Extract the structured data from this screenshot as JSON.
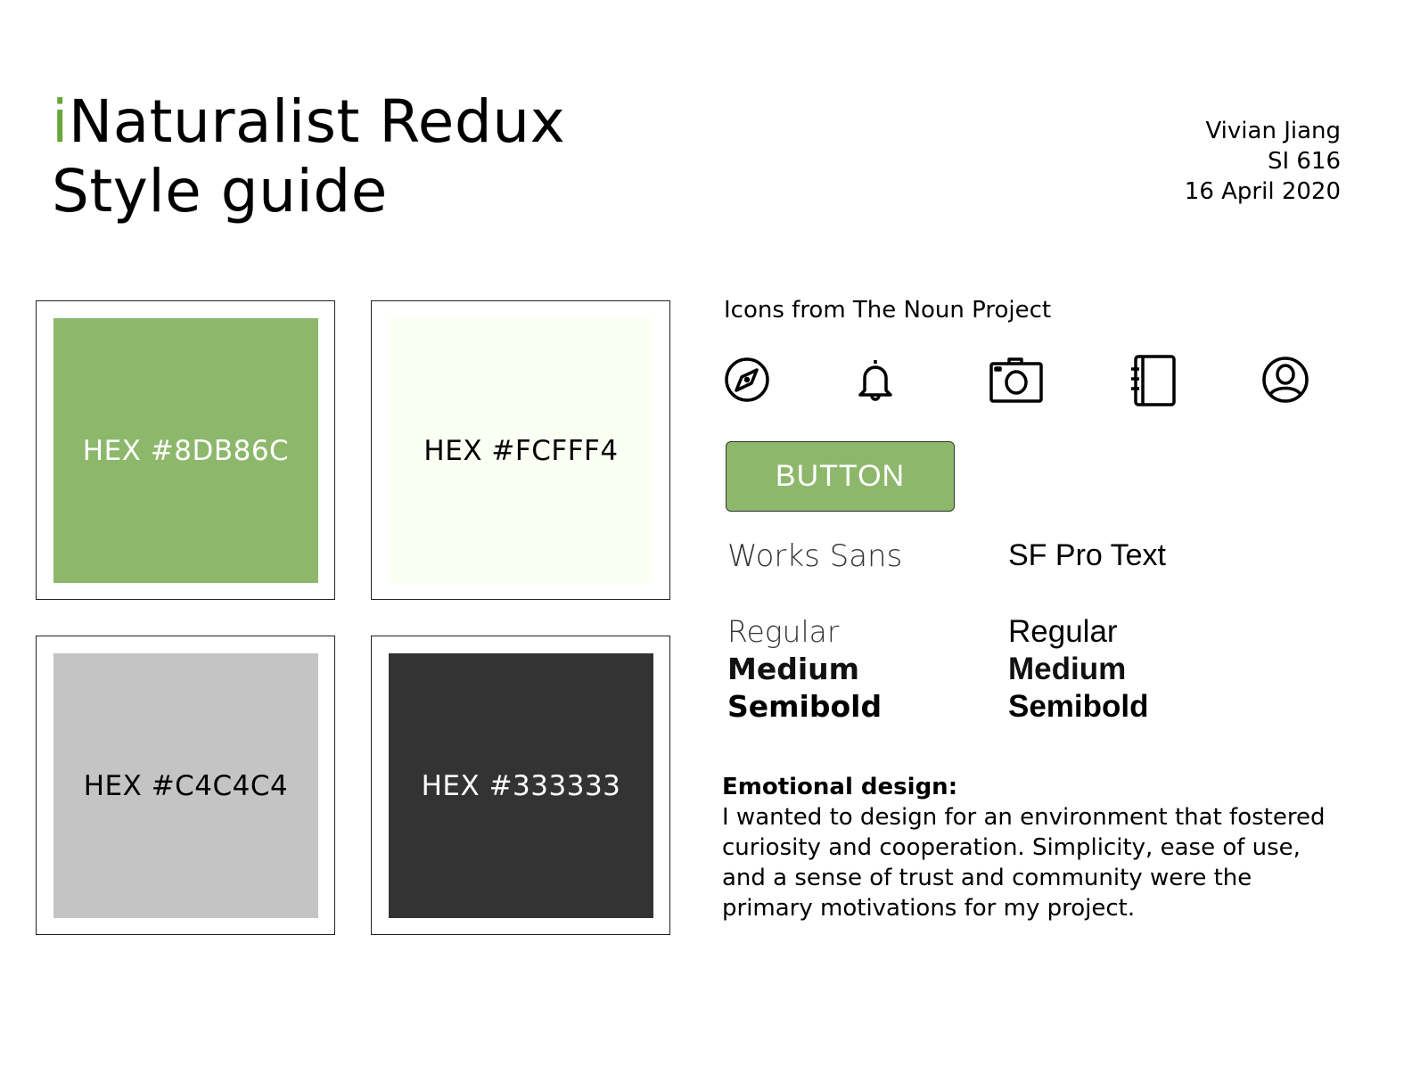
{
  "title": {
    "i": "i",
    "line1_rest": "Naturalist Redux",
    "line2": "Style guide"
  },
  "meta": {
    "author": "Vivian Jiang",
    "course": "SI 616",
    "date": "16 April 2020"
  },
  "swatches": [
    {
      "label": "HEX #8DB86C",
      "color": "#8DB86C",
      "text": "#ffffff"
    },
    {
      "label": "HEX #FCFFF4",
      "color": "#FCFFF4",
      "text": "#000000"
    },
    {
      "label": "HEX #C4C4C4",
      "color": "#C4C4C4",
      "text": "#000000"
    },
    {
      "label": "HEX #333333",
      "color": "#333333",
      "text": "#ffffff"
    }
  ],
  "icons": {
    "title": "Icons from The Noun Project",
    "items": [
      "compass-icon",
      "bell-icon",
      "camera-icon",
      "notebook-icon",
      "user-icon"
    ]
  },
  "button": {
    "label": "BUTTON"
  },
  "fonts": [
    {
      "name": "Works Sans",
      "weights": [
        "Regular",
        "Medium",
        "Semibold"
      ]
    },
    {
      "name": "SF Pro Text",
      "weights": [
        "Regular",
        "Medium",
        "Semibold"
      ]
    }
  ],
  "emotional": {
    "heading": "Emotional design:",
    "lines": [
      "I wanted to design for an environment that fostered",
      "curiosity and cooperation. Simplicity, ease of use,",
      "and a sense of trust and community were the",
      "primary motivations for my project."
    ]
  }
}
